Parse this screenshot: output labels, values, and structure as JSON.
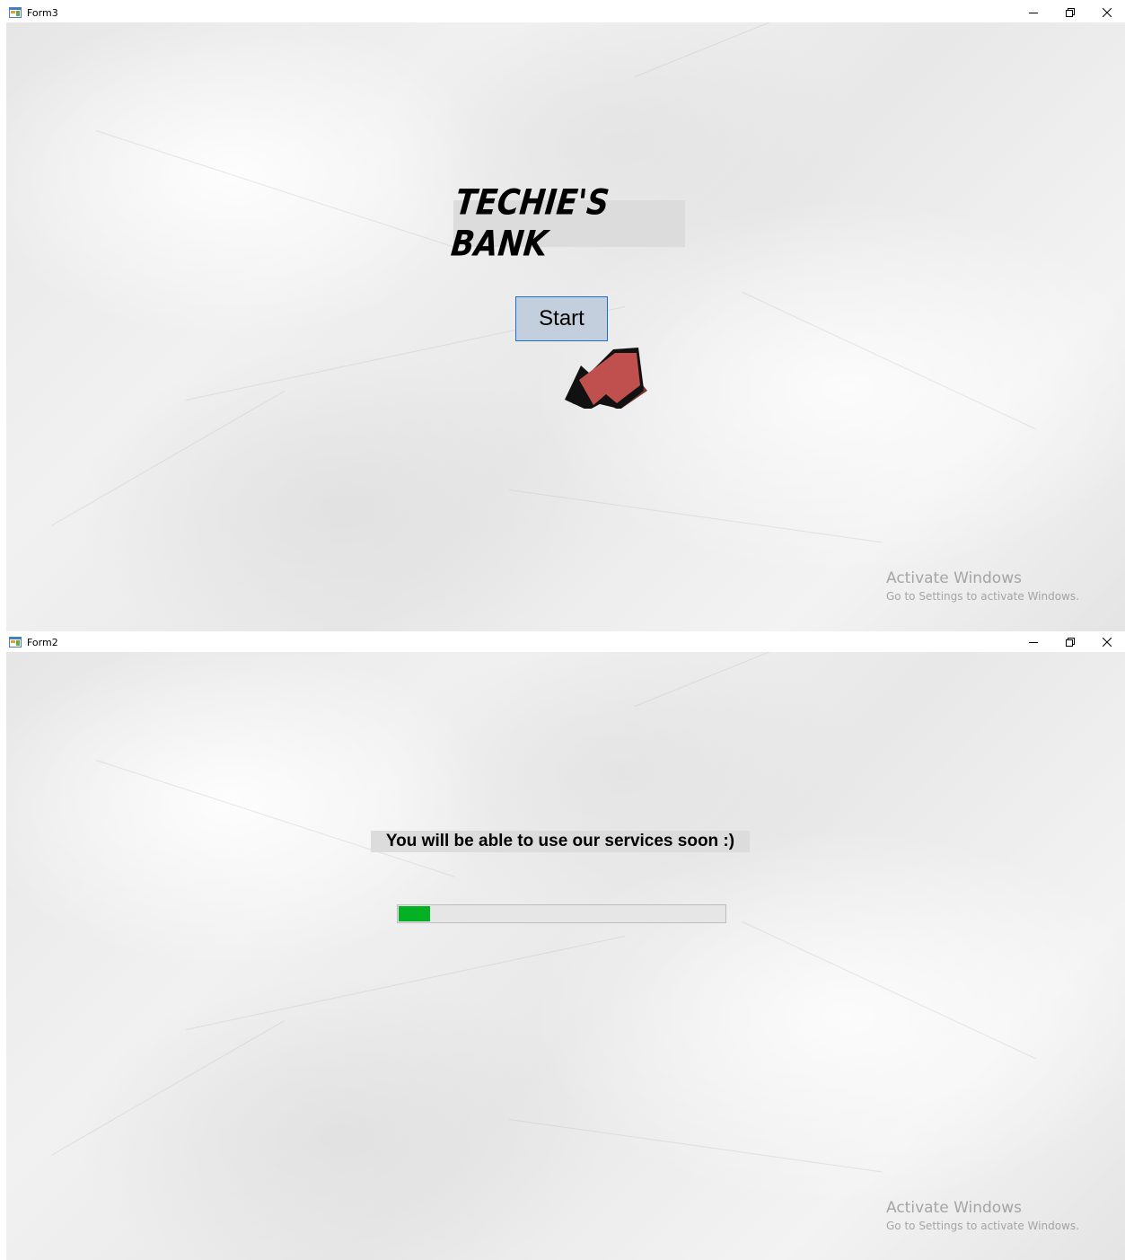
{
  "form3": {
    "title": "Form3",
    "bank_title": "TECHIE'S BANK",
    "start_label": "Start",
    "watermark_title": "Activate Windows",
    "watermark_sub": "Go to Settings to activate Windows."
  },
  "form2": {
    "title": "Form2",
    "status_text": "You will be able to use our services soon :)",
    "progress_percent": 10,
    "progress_color": "#06b025",
    "watermark_title": "Activate Windows",
    "watermark_sub": "Go to Settings to activate Windows."
  },
  "icons": {
    "minimize": "minimize-icon",
    "restore": "restore-icon",
    "close": "close-icon",
    "app": "app-icon",
    "arrow": "arrow-pointer-icon"
  },
  "colors": {
    "button_bg": "#c3cfdc",
    "button_border": "#1c6fc4",
    "arrow_fill": "#c0504d",
    "label_bg": "#dcdcdc"
  }
}
